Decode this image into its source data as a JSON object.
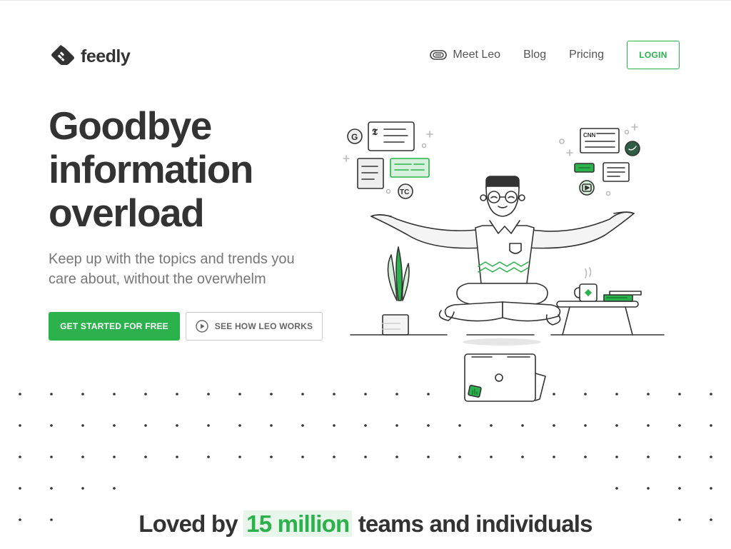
{
  "brand": {
    "name": "feedly",
    "logo_icon": "feedly-logo-icon",
    "accent_color": "#2bb24c"
  },
  "nav": {
    "items": [
      {
        "label": "Meet Leo",
        "icon": "leo-robot-icon"
      },
      {
        "label": "Blog"
      },
      {
        "label": "Pricing"
      }
    ],
    "login_label": "LOGIN"
  },
  "hero": {
    "title_lines": [
      "Goodbye",
      "information",
      "overload"
    ],
    "subtitle": "Keep up with the topics and trends you care about, without the overwhelm",
    "primary_cta": "GET STARTED FOR FREE",
    "secondary_cta": "SEE HOW LEO WORKS",
    "secondary_cta_icon": "play-circle-icon"
  },
  "tagline": {
    "prefix": "Loved by",
    "highlight": "15 million",
    "suffix": "teams and individuals"
  }
}
